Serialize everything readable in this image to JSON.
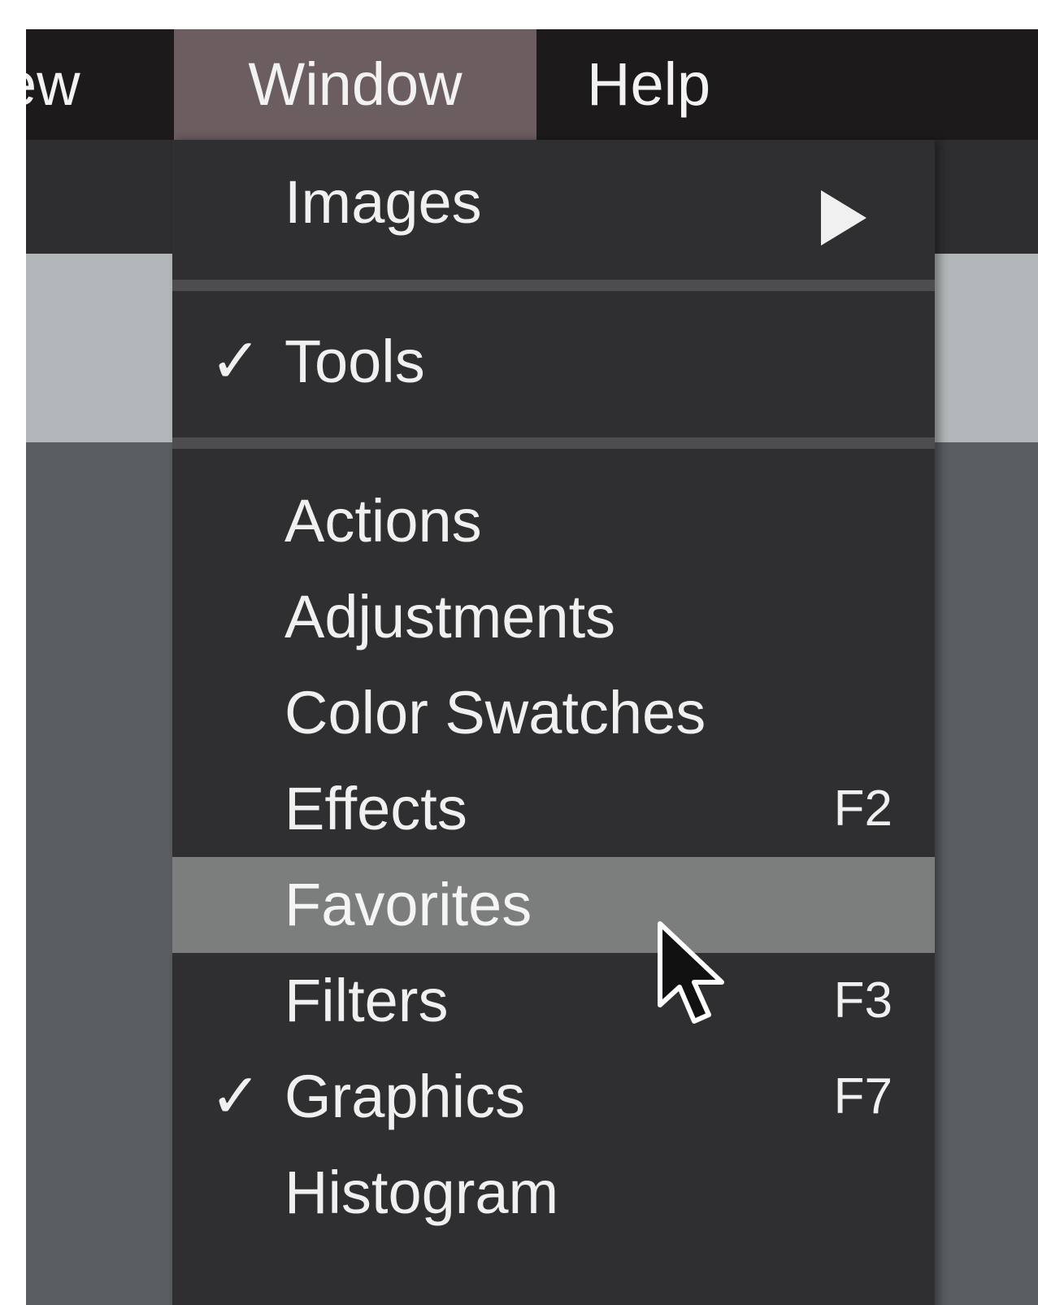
{
  "menubar": {
    "items": [
      {
        "label": "View",
        "visible_label": "ew"
      },
      {
        "label": "Window",
        "open": true
      },
      {
        "label": "Help"
      }
    ]
  },
  "menu": {
    "title": "Window",
    "items": [
      {
        "label": "Images",
        "has_submenu": true,
        "checked": false,
        "shortcut": ""
      },
      {
        "type": "separator"
      },
      {
        "label": "Tools",
        "checked": true,
        "checkmark": "✓",
        "shortcut": ""
      },
      {
        "type": "separator"
      },
      {
        "label": "Actions",
        "checked": false,
        "shortcut": ""
      },
      {
        "label": "Adjustments",
        "checked": false,
        "shortcut": ""
      },
      {
        "label": "Color Swatches",
        "checked": false,
        "shortcut": ""
      },
      {
        "label": "Effects",
        "checked": false,
        "shortcut": "F2"
      },
      {
        "label": "Favorites",
        "checked": false,
        "shortcut": "",
        "highlighted": true
      },
      {
        "label": "Filters",
        "checked": false,
        "shortcut": "F3"
      },
      {
        "label": "Graphics",
        "checked": true,
        "checkmark": "✓",
        "shortcut": "F7"
      },
      {
        "label": "Histogram",
        "checked": false,
        "shortcut": ""
      }
    ]
  },
  "icons": {
    "submenu": "chevron-right-icon",
    "check": "checkmark-icon",
    "cursor": "mouse-pointer-icon"
  },
  "colors": {
    "menubar_bg": "#1d1a1b",
    "menubar_open_bg": "#6b5d60",
    "menu_bg": "#2f2f31",
    "highlight_bg": "#7b7e7d",
    "text": "#f0f0f0"
  }
}
